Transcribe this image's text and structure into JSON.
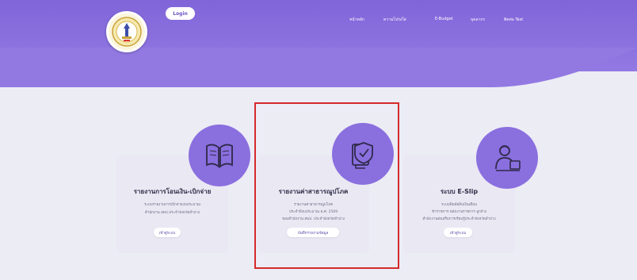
{
  "header": {
    "login_label": "Login",
    "nav": [
      "หน้าหลัก",
      "ความโปร่งใส",
      "E-Budget",
      "บุคลากร",
      "ติดต่อ Test"
    ]
  },
  "cards": [
    {
      "title": "รายงานการโอนเงิน-เบิกจ่าย",
      "desc": [
        "ระบบรายงานการเบิกจ่ายงบประมาณ",
        "สำนักงาน สพป.ประจำจังหวัดลำปาง"
      ],
      "button": "เข้าสู่ระบบ"
    },
    {
      "title": "รายงานค่าสาธารณูปโภค",
      "desc": [
        "รายงานค่าสาธารณูปโภค",
        "ประจำปีงบประมาณ พ.ศ. 2569",
        "ของสำนักงาน สพป. ประจำจังหวัดลำปาง"
      ],
      "button": "บันทึกรายงานข้อมูล"
    },
    {
      "title": "ระบบ E-Slip",
      "desc": [
        "ระบบพิมพ์สลิปเงินเดือน",
        "ข้าราชการ พนักงานราชการ ลูกจ้าง",
        "สำนักงานส่งเสริมการเรียนรู้ประจำจังหวัดลำปาง"
      ],
      "button": "เข้าสู่ระบบ"
    }
  ],
  "colors": {
    "header": "#8065d9",
    "circle": "#8a6fdf",
    "card": "#eae8f3",
    "highlight": "#d42a2a"
  },
  "icons": [
    "open-book-icon",
    "shield-book-icon",
    "person-laptop-icon"
  ]
}
